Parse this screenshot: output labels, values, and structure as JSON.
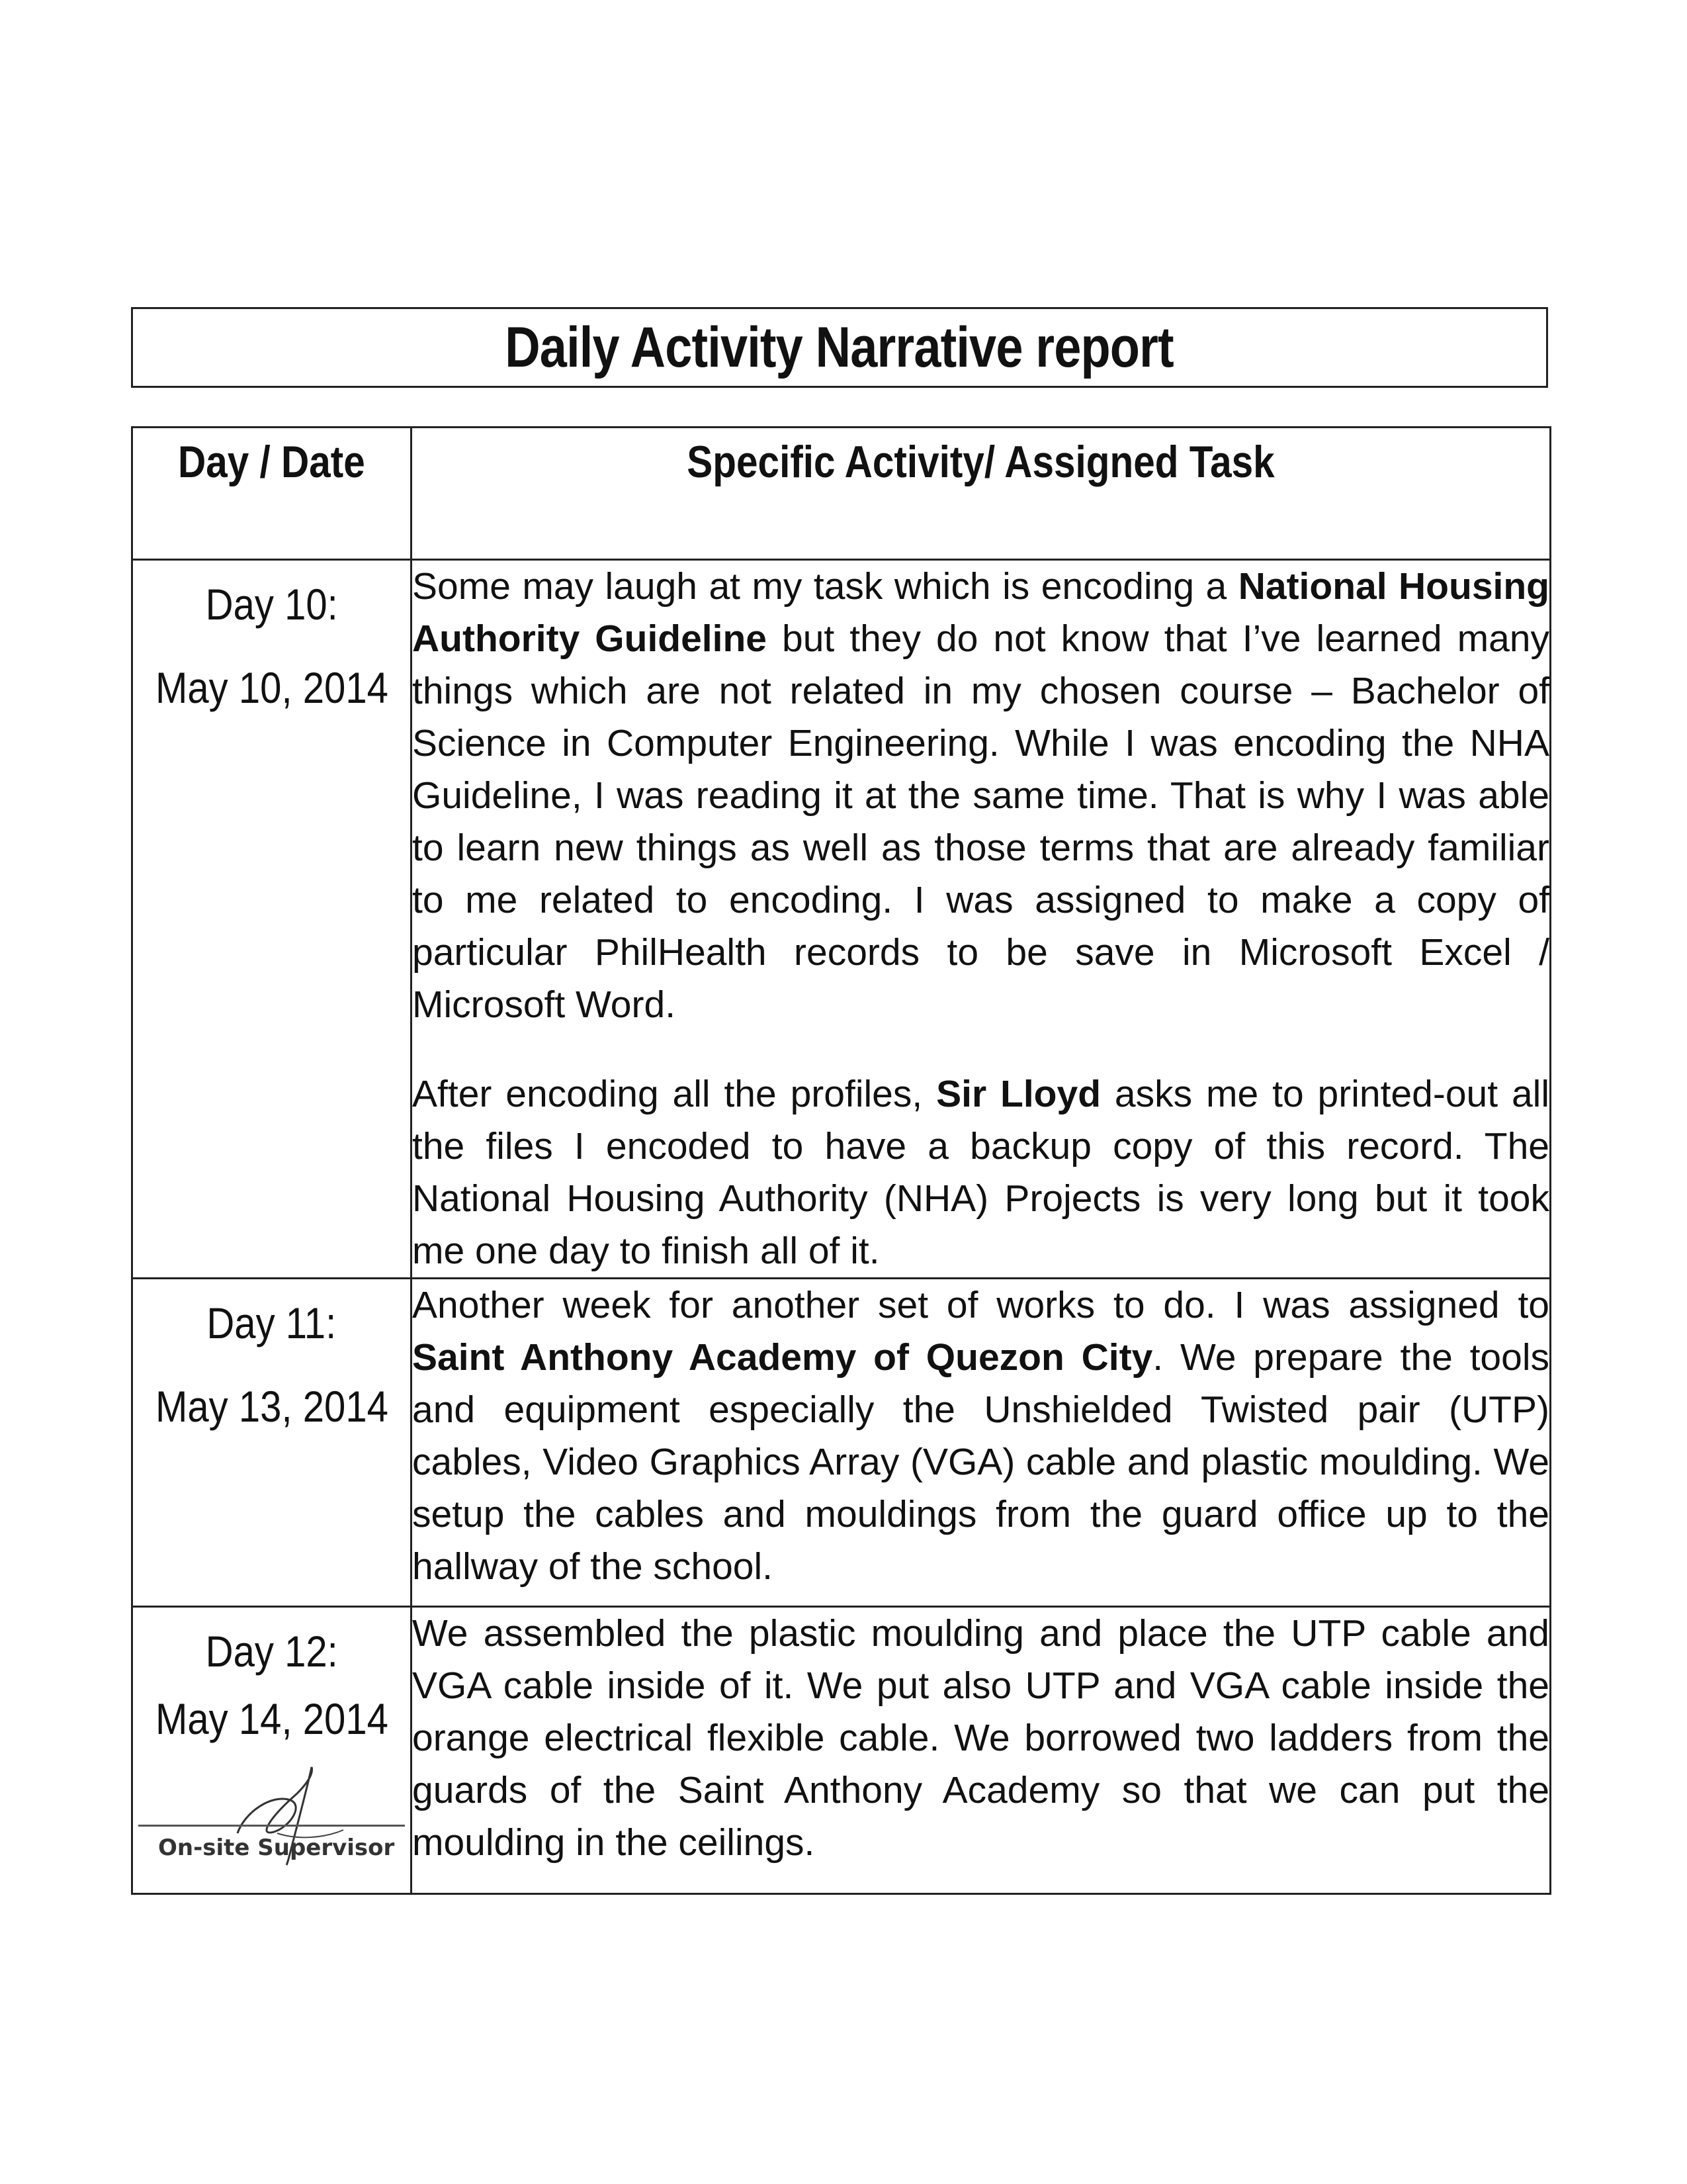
{
  "title": "Daily Activity Narrative report",
  "table": {
    "headers": {
      "day": "Day / Date",
      "task": "Specific Activity/ Assigned Task"
    },
    "rows": [
      {
        "day": "Day 10:",
        "date": "May 10, 2014",
        "paragraphs": [
          [
            {
              "text": "Some may laugh at my task which is encoding a ",
              "bold": false
            },
            {
              "text": "National Housing Authority Guideline",
              "bold": true
            },
            {
              "text": " but they do not know that I’ve learned many things which are not related in my chosen course – Bachelor of Science in Computer Engineering. While I was encoding the NHA Guideline, I was reading it at the same time. That is why I was able to learn new things as well as those terms that are already familiar to me related to encoding. I was assigned to make a copy of particular PhilHealth records to be save in Microsoft Excel / Microsoft Word.",
              "bold": false
            }
          ],
          [
            {
              "text": "After encoding all the profiles, ",
              "bold": false
            },
            {
              "text": "Sir Lloyd",
              "bold": true
            },
            {
              "text": " asks me to printed-out all the files I encoded to have a backup copy of this record. The National Housing Authority (NHA) Projects is very long but it took me one day to finish all of it.",
              "bold": false
            }
          ]
        ]
      },
      {
        "day": "Day 11:",
        "date": "May 13, 2014",
        "paragraphs": [
          [
            {
              "text": "Another week for another set of works to do. I was assigned to ",
              "bold": false
            },
            {
              "text": "Saint Anthony Academy of Quezon City",
              "bold": true
            },
            {
              "text": ". We prepare the tools and equipment especially the Unshielded Twisted pair (UTP) cables, Video Graphics Array (VGA) cable and plastic moulding. We setup the cables and mouldings from the guard office up to the hallway of the school.",
              "bold": false
            }
          ]
        ]
      },
      {
        "day": "Day 12:",
        "date": "May 14, 2014",
        "paragraphs": [
          [
            {
              "text": "We assembled the plastic moulding and place the UTP cable and VGA cable inside of it. We put also UTP and VGA cable inside the orange electrical flexible cable. We borrowed two ladders from the guards of the Saint Anthony Academy so that we can put the moulding in the ceilings.",
              "bold": false
            }
          ]
        ],
        "signature_label": "On-site Supervisor"
      }
    ]
  }
}
